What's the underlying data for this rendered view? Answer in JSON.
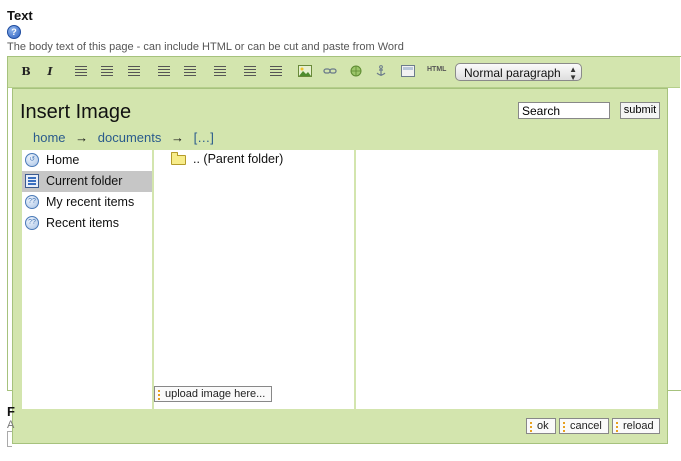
{
  "field": {
    "label": "Text",
    "help_icon": "?",
    "description": "The body text of this page - can include HTML or can be cut and paste from Word"
  },
  "toolbar": {
    "bold": "B",
    "italic": "I",
    "html_label": "HTML",
    "format_select": "Normal paragraph",
    "icons": [
      "bold-icon",
      "italic-icon",
      "align-left-icon",
      "align-center-icon",
      "align-right-icon",
      "ordered-list-icon",
      "unordered-list-icon",
      "outdent-icon",
      "indent-icon",
      "outdent2-icon",
      "insert-image-icon",
      "insert-link-icon",
      "insert-globe-icon",
      "anchor-icon",
      "table-icon",
      "html-source-icon"
    ]
  },
  "dialog": {
    "title": "Insert Image",
    "search_value": "Search",
    "submit_label": "submit",
    "breadcrumb": [
      "home",
      "documents",
      "[…]"
    ],
    "breadcrumb_sep": "→",
    "nav_items": [
      {
        "label": "Home",
        "icon": "home-icon",
        "active": false
      },
      {
        "label": "Current folder",
        "icon": "folder-page-icon",
        "active": true
      },
      {
        "label": "My recent items",
        "icon": "recent-icon",
        "active": false
      },
      {
        "label": "Recent items",
        "icon": "recent-icon",
        "active": false
      }
    ],
    "files": [
      {
        "label": ".. (Parent folder)",
        "icon": "folder-icon"
      }
    ],
    "upload_label": "upload image here...",
    "ok_label": "ok",
    "cancel_label": "cancel",
    "reload_label": "reload"
  },
  "background": {
    "next_field_label": "F",
    "next_field_desc": "A"
  },
  "colors": {
    "panel_green": "#d3e5ae",
    "border_green": "#a6c27d",
    "link_blue": "#2a5b8c",
    "active_gray": "#c6c6c6"
  }
}
